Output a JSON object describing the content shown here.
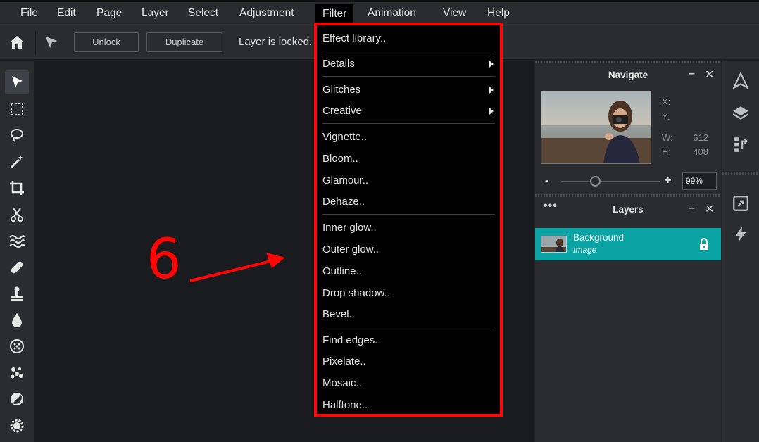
{
  "menubar": {
    "items": [
      "File",
      "Edit",
      "Page",
      "Layer",
      "Select",
      "Adjustment",
      "Filter",
      "Animation",
      "View",
      "Help"
    ]
  },
  "toolbar": {
    "unlock_label": "Unlock",
    "duplicate_label": "Duplicate",
    "status_text": "Layer is locked. Unlock to enable transforms."
  },
  "filter_menu": {
    "groups": [
      [
        "Effect library.."
      ],
      [
        "Details",
        "Glitches",
        "Creative"
      ],
      [
        "Vignette..",
        "Bloom..",
        "Glamour..",
        "Dehaze.."
      ],
      [
        "Inner glow..",
        "Outer glow..",
        "Outline..",
        "Drop shadow..",
        "Bevel.."
      ],
      [
        "Find edges..",
        "Pixelate..",
        "Mosaic..",
        "Halftone.."
      ]
    ],
    "items": {
      "effect_library": "Effect library..",
      "details": "Details",
      "glitches": "Glitches",
      "creative": "Creative",
      "vignette": "Vignette..",
      "bloom": "Bloom..",
      "glamour": "Glamour..",
      "dehaze": "Dehaze..",
      "inner_glow": "Inner glow..",
      "outer_glow": "Outer glow..",
      "outline": "Outline..",
      "drop_shadow": "Drop shadow..",
      "bevel": "Bevel..",
      "find_edges": "Find edges..",
      "pixelate": "Pixelate..",
      "mosaic": "Mosaic..",
      "halftone": "Halftone.."
    }
  },
  "navigate_panel": {
    "title": "Navigate",
    "x_label": "X:",
    "y_label": "Y:",
    "w_label": "W:",
    "w_value": "612",
    "h_label": "H:",
    "h_value": "408",
    "zoom_minus": "-",
    "zoom_plus": "+",
    "zoom_value": "99%"
  },
  "layers_panel": {
    "title": "Layers",
    "layer_name": "Background",
    "layer_type": "Image"
  },
  "annotation": {
    "number": "6"
  },
  "colors": {
    "accent_teal": "#0aa4a4",
    "highlight_red": "#ff0505",
    "panel_bg": "#2a2c30",
    "canvas_bg": "#1a1b1e"
  }
}
